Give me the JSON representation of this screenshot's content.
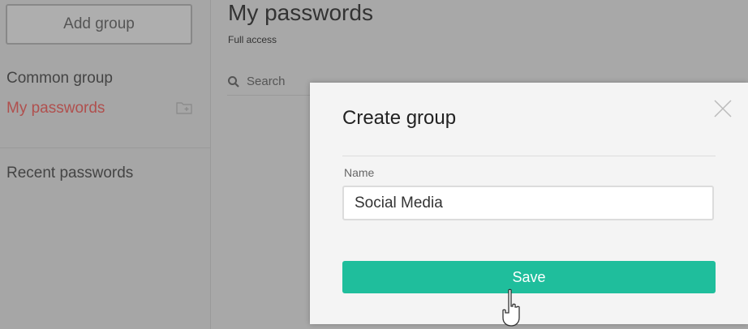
{
  "sidebar": {
    "add_group_label": "Add group",
    "items": [
      {
        "label": "Common group"
      },
      {
        "label": "My passwords",
        "active": true
      },
      {
        "label": "Recent passwords"
      }
    ],
    "active_color": "#b0504e"
  },
  "main": {
    "title": "My passwords",
    "subtitle": "Full access",
    "search_placeholder": "Search"
  },
  "modal": {
    "title": "Create group",
    "name_label": "Name",
    "name_value": "Social Media",
    "save_label": "Save",
    "save_color": "#1fbe9c"
  },
  "icons": [
    "folder-add-icon",
    "search-icon",
    "close-icon",
    "hand-pointer-cursor"
  ]
}
